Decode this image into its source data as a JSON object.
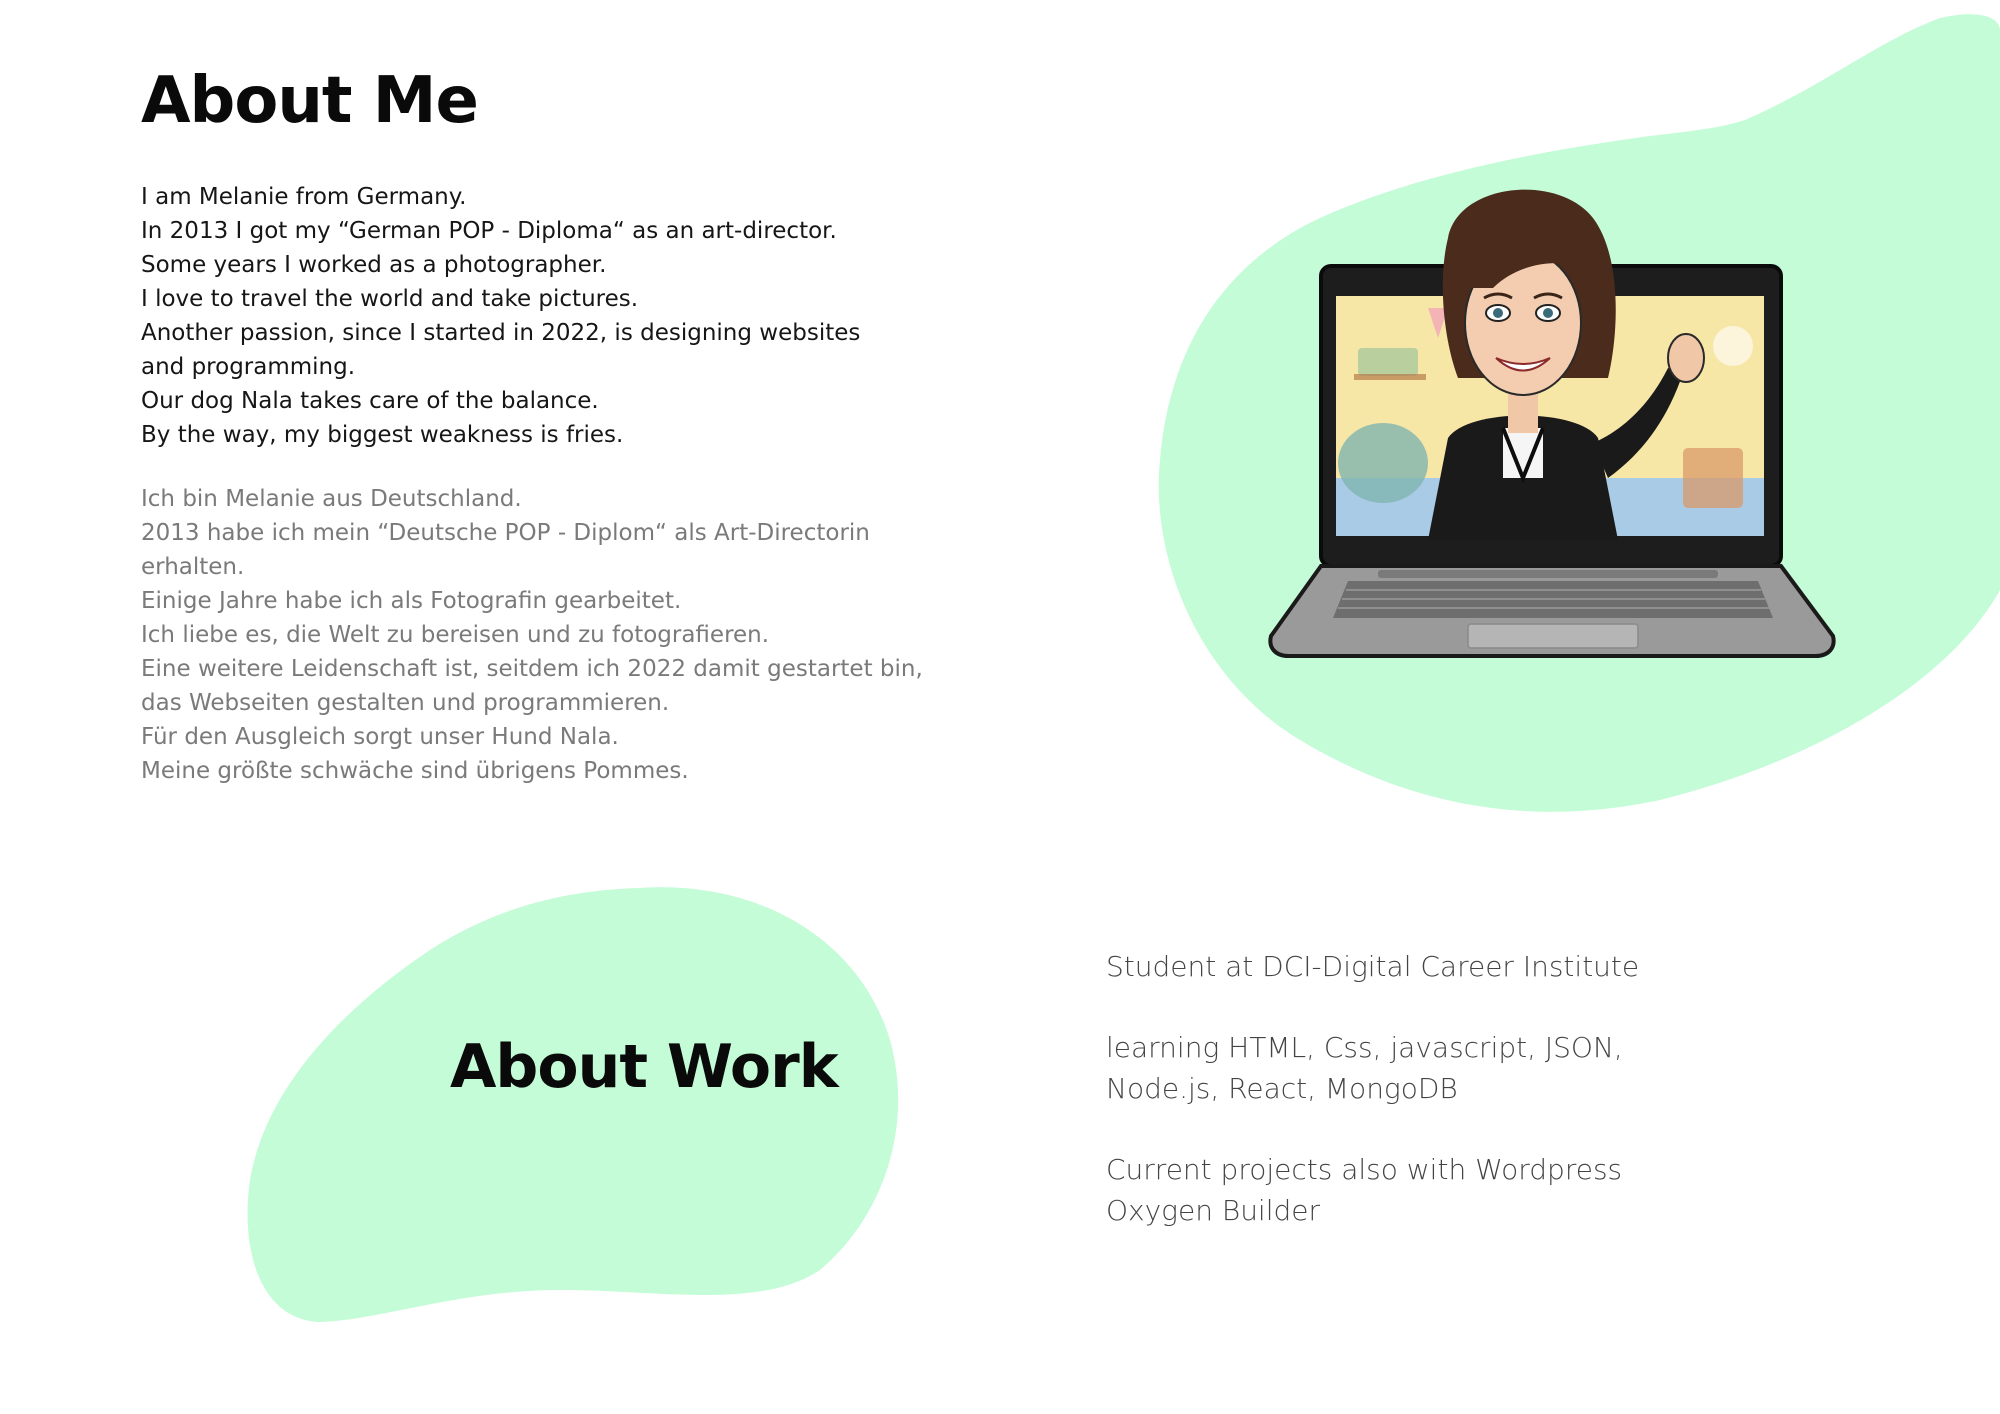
{
  "about_me": {
    "title": "About Me",
    "text_en": "I am Melanie from Germany.\nIn 2013 I got my “German POP - Diploma“ as an art-director.\nSome years I worked as a photographer.\nI love to travel the world and take pictures.\nAnother passion, since I started in 2022, is designing websites\nand programming.\nOur dog Nala takes care of the balance.\nBy the way, my biggest weakness is fries.",
    "text_de": "Ich bin Melanie aus Deutschland.\n2013 habe ich mein “Deutsche POP - Diplom“ als Art-Directorin\nerhalten.\nEinige Jahre habe ich als Fotografin gearbeitet.\nIch liebe es, die Welt zu bereisen und zu fotografieren.\nEine weitere Leidenschaft ist, seitdem ich 2022 damit gestartet bin,\ndas Webseiten gestalten und programmieren.\nFür den Ausgleich sorgt unser Hund Nala.\nMeine größte schwäche sind übrigens Pommes."
  },
  "about_work": {
    "title": "About Work",
    "items": [
      "Student at DCI-Digital Career Institute",
      "learning HTML, Css, javascript, JSON,\nNode.js, React, MongoDB",
      "Current projects also with Wordpress\nOxygen Builder"
    ]
  },
  "illustration": {
    "icon": "avatar-laptop-illustration"
  },
  "colors": {
    "blob": "#c3fcd6",
    "heading": "#0a0a0a",
    "text_primary": "#161616",
    "text_secondary": "#7a7a7a",
    "work_text": "#444444"
  }
}
